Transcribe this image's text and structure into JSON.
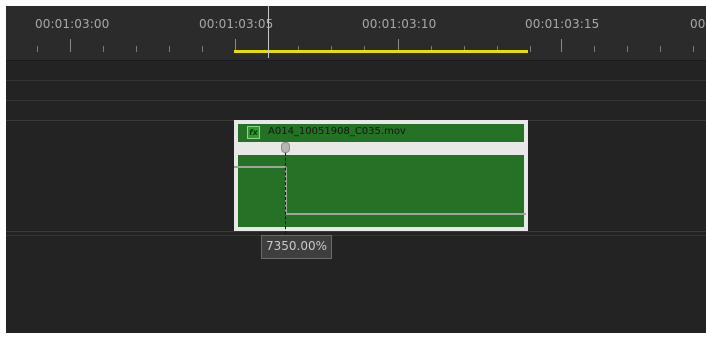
{
  "ruler": {
    "timecodes": [
      "00:01:03:00",
      "00:01:03:05",
      "00:01:03:10",
      "00:01:03:15",
      "00"
    ]
  },
  "clip": {
    "name": "A014_10051908_C035.mov",
    "badge": "fx"
  },
  "tooltip": {
    "value": "7350.00%"
  },
  "colors": {
    "background": "#232323",
    "clip_green": "#257126",
    "work_area": "#e5df00",
    "clip_frame": "#e8e8e8"
  }
}
